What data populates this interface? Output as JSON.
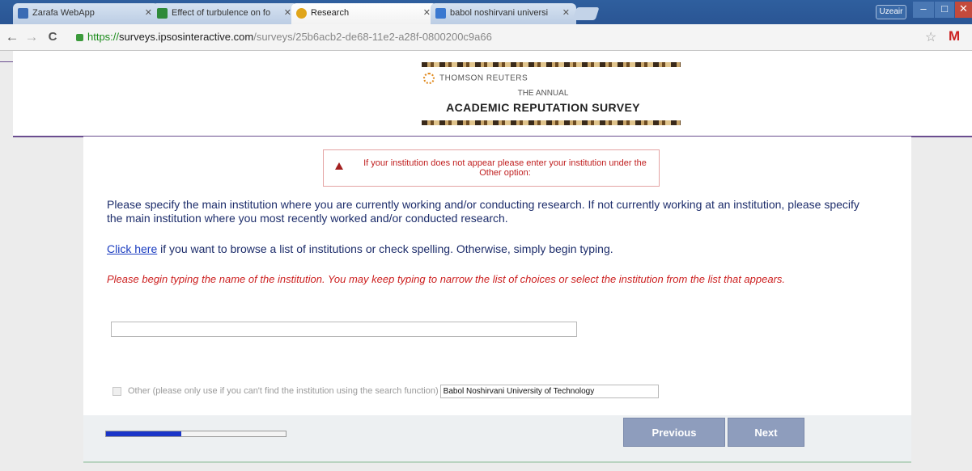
{
  "browser": {
    "tabs": [
      {
        "title": "Zarafa WebApp",
        "active": false,
        "favicon_color": "#3a6bb4"
      },
      {
        "title": "Effect of turbulence on fo",
        "active": false,
        "favicon_color": "#2f8a3a"
      },
      {
        "title": "Research",
        "active": true,
        "favicon_color": "#e0a51a"
      },
      {
        "title": "babol noshirvani universi",
        "active": false,
        "favicon_color": "#3a78d0"
      }
    ],
    "user_button": "Uzeair",
    "url": {
      "https": "https://",
      "host": "surveys.ipsosinteractive.com",
      "path": "/surveys/25b6acb2-de68-11e2-a28f-0800200c9a66"
    },
    "icons": {
      "back": "←",
      "forward": "→",
      "reload": "C",
      "star": "☆",
      "gmail": "M",
      "close_tab": "✕",
      "min": "–",
      "max": "□",
      "close": "✕"
    }
  },
  "header": {
    "brand": "THOMSON REUTERS",
    "subtitle": "THE ANNUAL",
    "title": "ACADEMIC REPUTATION SURVEY"
  },
  "survey": {
    "alert_text": "If your institution does not appear please enter your institution under the Other option:",
    "intro": "Please specify the main institution where you are currently working and/or conducting research. If not currently working at an institution, please specify the main institution where you most recently worked and/or conducted research.",
    "browse_link": "Click here",
    "browse_rest": " if you want to browse a list of institutions or check spelling. Otherwise, simply begin typing.",
    "instruction": "Please begin typing the name of the institution. You may keep typing to narrow the list of choices or select the institution from the list that appears.",
    "search_value": "",
    "other_label": "Other (please only use if you can't find the institution using the search function)",
    "other_value": "Babol Noshirvani University of Technology",
    "progress": 0.42,
    "previous_label": "Previous",
    "next_label": "Next"
  }
}
